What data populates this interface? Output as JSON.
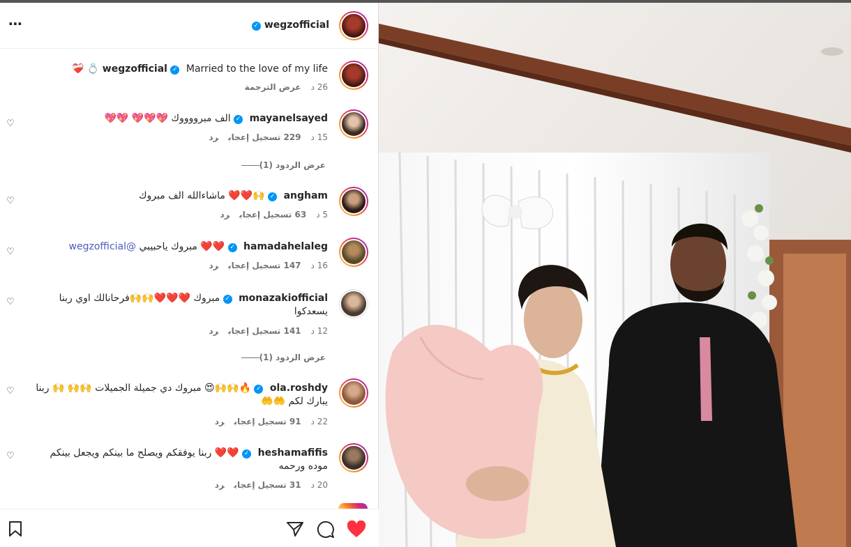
{
  "post": {
    "author": "wegzofficial",
    "caption": "Married to the love of my life 💍 ❤️‍🩹",
    "age": "26 د",
    "translate": "عرض الترجمة"
  },
  "comments": [
    {
      "user": "mayanelsayed",
      "text": "الف مبرووووك 💖💖💖 💖💖",
      "age": "15 د",
      "likes": "229 تسجيل إعجاب",
      "reply": "رد",
      "replies": "عرض الردود (1)"
    },
    {
      "user": "angham",
      "text": "🙌❤️❤️ ماشاءالله الف مبروك",
      "age": "5 د",
      "likes": "63 تسجيل إعجاب",
      "reply": "رد"
    },
    {
      "user": "hamadahelaleg",
      "text": "❤️❤️ مبروك ياحبيبي ",
      "mention": "@wegzofficial",
      "age": "16 د",
      "likes": "147 تسجيل إعجاب",
      "reply": "رد"
    },
    {
      "user": "monazakiofficial",
      "text": "مبروك ❤️❤️❤️🙌🙌فرحانالك اوي ربنا يسعدكوا",
      "age": "12 د",
      "likes": "141 تسجيل إعجاب",
      "reply": "رد",
      "replies": "عرض الردود (1)"
    },
    {
      "user": "ola.roshdy",
      "text": "🔥🙌🙌😍 مبروك دي جميلة الجميلات 🙌🙌 🙌 ربنا يبارك لكم 🤲🤲",
      "age": "22 د",
      "likes": "91 تسجيل إعجاب",
      "reply": "رد"
    },
    {
      "user": "heshamafifis",
      "text": "❤️❤️ ربنا يوفقكم ويصلح ما بينكم ويجعل بينكم موده ورحمه",
      "age": "20 د",
      "likes": "31 تسجيل إعجاب",
      "reply": "رد"
    }
  ],
  "icons": {
    "more": "more-options-icon",
    "verified": "verified-badge-icon",
    "like": "heart-outline-icon",
    "liked": "heart-filled-icon",
    "comment": "comment-bubble-icon",
    "share": "paper-plane-icon",
    "save": "bookmark-icon"
  },
  "colors": {
    "verified": "#0095f6",
    "liked": "#ff3040",
    "mention": "#4a5dbd"
  }
}
